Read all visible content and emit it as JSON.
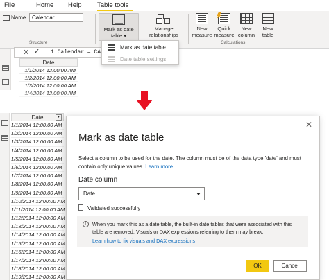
{
  "menubar": {
    "items": [
      "File",
      "Home",
      "Help",
      "Table tools"
    ],
    "active": "Table tools"
  },
  "ribbon": {
    "name_label": "Name",
    "name_value": "Calendar",
    "structure_label": "Structure",
    "calculations_label": "Calculations",
    "buttons": {
      "mark_as_date_table": "Mark as date table",
      "manage_relationships": "Manage relationships",
      "new_measure": "New measure",
      "quick_measure": "Quick measure",
      "new_column": "New column",
      "new_table": "New table"
    }
  },
  "dropdown": {
    "items": [
      {
        "label": "Mark as date table",
        "enabled": true
      },
      {
        "label": "Date table settings",
        "enabled": false
      }
    ]
  },
  "formula_bar": {
    "text": "1  Calendar = CALENDAR("
  },
  "grid_top": {
    "header": "Date",
    "rows": [
      "1/1/2014 12:00:00 AM",
      "1/2/2014 12:00:00 AM",
      "1/3/2014 12:00:00 AM",
      "1/4/2014 12:00:00 AM"
    ]
  },
  "grid_bottom": {
    "header": "Date",
    "rows": [
      "1/1/2014 12:00:00 AM",
      "1/2/2014 12:00:00 AM",
      "1/3/2014 12:00:00 AM",
      "1/4/2014 12:00:00 AM",
      "1/5/2014 12:00:00 AM",
      "1/6/2014 12:00:00 AM",
      "1/7/2014 12:00:00 AM",
      "1/8/2014 12:00:00 AM",
      "1/9/2014 12:00:00 AM",
      "1/10/2014 12:00:00 AM",
      "1/11/2014 12:00:00 AM",
      "1/12/2014 12:00:00 AM",
      "1/13/2014 12:00:00 AM",
      "1/14/2014 12:00:00 AM",
      "1/15/2014 12:00:00 AM",
      "1/16/2014 12:00:00 AM",
      "1/17/2014 12:00:00 AM",
      "1/18/2014 12:00:00 AM",
      "1/19/2014 12:00:00 AM"
    ]
  },
  "dialog": {
    "title": "Mark as date table",
    "close_glyph": "✕",
    "description": "Select a column to be used for the date. The column must be of the data type 'date' and must contain only unique values.",
    "learn_more": "Learn more",
    "date_column_label": "Date column",
    "date_column_value": "Date",
    "validation": "Validated successfully",
    "info_text": "When you mark this as a date table, the built-in date tables that were associated with this table are removed. Visuals or DAX expressions referring to them may break.",
    "info_link": "Learn how to fix visuals and DAX expressions",
    "ok_label": "OK",
    "cancel_label": "Cancel"
  },
  "colors": {
    "accent_yellow": "#f2c811",
    "tab_green": "#0f6b5a",
    "arrow_red": "#e81123",
    "link_blue": "#0f6cbd"
  }
}
